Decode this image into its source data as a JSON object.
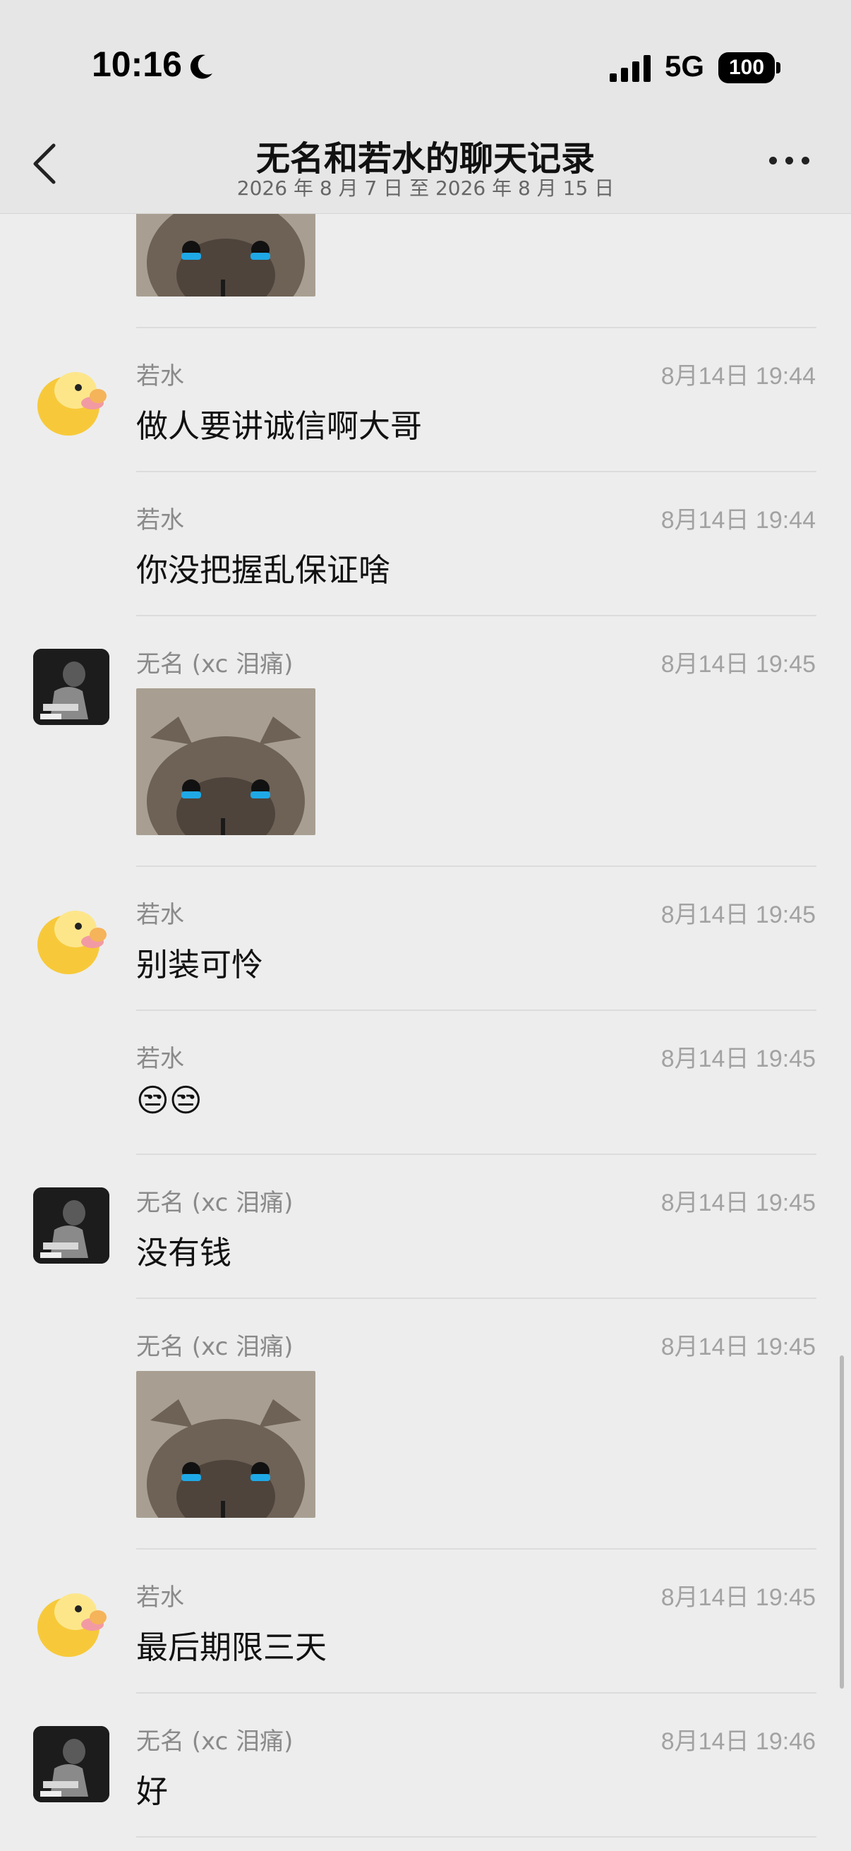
{
  "status_bar": {
    "time": "10:16",
    "network": "5G",
    "battery": "100"
  },
  "header": {
    "title": "无名和若水的聊天记录",
    "subtitle": "2026 年 8 月 7 日 至 2026 年 8 月 15 日"
  },
  "messages": [
    {
      "sender": "若水",
      "time": "8月14日 19:44",
      "text": "做人要讲诚信啊大哥"
    },
    {
      "sender": "若水",
      "time": "8月14日 19:44",
      "text": "你没把握乱保证啥"
    },
    {
      "sender": "无名 (xc 泪痛)",
      "time": "8月14日 19:45",
      "sticker": "crying-cat-sticker"
    },
    {
      "sender": "若水",
      "time": "8月14日 19:45",
      "text": "别装可怜"
    },
    {
      "sender": "若水",
      "time": "8月14日 19:45",
      "text": "😒😒"
    },
    {
      "sender": "无名 (xc 泪痛)",
      "time": "8月14日 19:45",
      "text": "没有钱"
    },
    {
      "sender": "无名 (xc 泪痛)",
      "time": "8月14日 19:45",
      "sticker": "crying-cat-sticker"
    },
    {
      "sender": "若水",
      "time": "8月14日 19:45",
      "text": "最后期限三天"
    },
    {
      "sender": "无名 (xc 泪痛)",
      "time": "8月14日 19:46",
      "text": "好"
    }
  ],
  "icons": {
    "back": "chevron-left-icon",
    "more": "more-dots-icon",
    "moon": "moon-icon",
    "signal": "signal-icon"
  }
}
